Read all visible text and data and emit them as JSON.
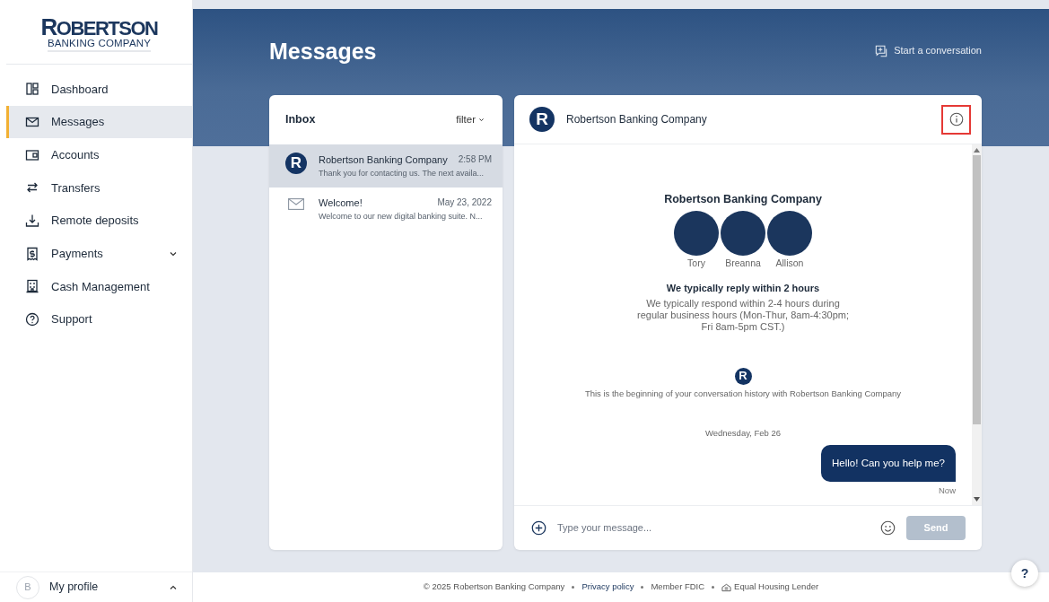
{
  "brand": {
    "name": "ROBERTSON",
    "tagline": "BANKING COMPANY"
  },
  "sidebar": {
    "items": [
      {
        "label": "Dashboard",
        "selected": false
      },
      {
        "label": "Messages",
        "selected": true
      },
      {
        "label": "Accounts",
        "selected": false
      },
      {
        "label": "Transfers",
        "selected": false
      },
      {
        "label": "Remote deposits",
        "selected": false
      },
      {
        "label": "Payments",
        "selected": false,
        "expanded": false
      },
      {
        "label": "Cash Management",
        "selected": false
      },
      {
        "label": "Support",
        "selected": false
      }
    ],
    "profile": {
      "initial": "B",
      "label": "My profile",
      "expanded": false
    }
  },
  "page": {
    "title": "Messages",
    "start_action": "Start a conversation"
  },
  "inbox": {
    "title": "Inbox",
    "filter": "filter",
    "threads": [
      {
        "kind": "avatar",
        "initial": "R",
        "sender": "Robertson Banking Company",
        "time": "2:58 PM",
        "preview": "Thank you for contacting us. The next availa...",
        "selected": true
      },
      {
        "kind": "mail",
        "sender": "Welcome!",
        "time": "May 23, 2022",
        "preview": "Welcome to our new digital banking suite. N...",
        "selected": false
      }
    ]
  },
  "chat": {
    "avatar_initial": "R",
    "title": "Robertson Banking Company",
    "info_highlighted": true,
    "intro": {
      "name": "Robertson Banking Company",
      "agents": [
        {
          "name": "Tory"
        },
        {
          "name": "Breanna"
        },
        {
          "name": "Allison"
        }
      ],
      "reply_title": "We typically reply within 2 hours",
      "reply_detail": "We typically respond within 2-4 hours during regular business hours (Mon-Thur, 8am-4:30pm; Fri 8am-5pm CST.)",
      "logo_initial": "R",
      "history_note": "This is the beginning of your conversation history with Robertson Banking Company"
    },
    "date": "Wednesday, Feb 26",
    "messages": [
      {
        "text": "Hello! Can you help me?",
        "time": "Now"
      }
    ],
    "composer": {
      "placeholder": "Type your message...",
      "send": "Send",
      "send_disabled": true
    }
  },
  "footer": {
    "copyright": "© 2025 Robertson Banking Company",
    "links": [
      {
        "kind": "link",
        "text": "Privacy policy"
      },
      {
        "kind": "text",
        "text": "Member FDIC"
      },
      {
        "kind": "housing",
        "text": "Equal Housing Lender"
      }
    ],
    "help": "?"
  }
}
